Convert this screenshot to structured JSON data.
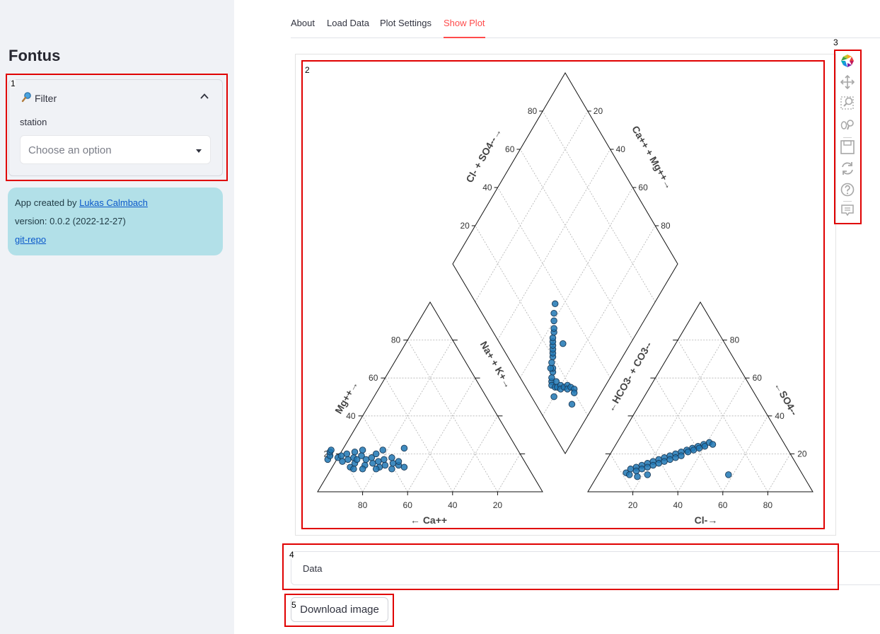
{
  "app": {
    "title": "Fontus"
  },
  "sidebar": {
    "filter": {
      "label": "Filter",
      "station_label": "station",
      "placeholder": "Choose an option"
    },
    "info": {
      "created_prefix": "App created by ",
      "author_link": "Lukas Calmbach",
      "version": "version: 0.0.2 (2022-12-27)",
      "repo_link": "git-repo"
    }
  },
  "tabs": [
    {
      "label": "About"
    },
    {
      "label": "Load Data"
    },
    {
      "label": "Plot Settings"
    },
    {
      "label": "Show Plot",
      "active": true
    }
  ],
  "chart_data": {
    "type": "scatter",
    "subtype": "piper-diagram",
    "marker_color": "#1f77b4",
    "axis_labels": {
      "cation_left": "Mg++",
      "cation_right": "Na+ + K+",
      "cation_bottom": "Ca++",
      "anion_left": "HCO3- + CO3--",
      "anion_right": "SO4--",
      "anion_bottom": "Cl-",
      "diamond_upper_left": "Cl- + SO4--",
      "diamond_upper_right": "Ca++ + Mg++"
    },
    "ticks": [
      20,
      40,
      60,
      80
    ],
    "grid": true,
    "cation_points": [
      {
        "ca": 87,
        "mg": 17
      },
      {
        "ca": 85,
        "mg": 19
      },
      {
        "ca": 84,
        "mg": 21
      },
      {
        "ca": 83,
        "mg": 22
      },
      {
        "ca": 82,
        "mg": 18
      },
      {
        "ca": 81,
        "mg": 16
      },
      {
        "ca": 80,
        "mg": 19
      },
      {
        "ca": 79,
        "mg": 13
      },
      {
        "ca": 78,
        "mg": 17
      },
      {
        "ca": 77,
        "mg": 20
      },
      {
        "ca": 76,
        "mg": 15
      },
      {
        "ca": 75,
        "mg": 18
      },
      {
        "ca": 74,
        "mg": 17
      },
      {
        "ca": 73,
        "mg": 21
      },
      {
        "ca": 72,
        "mg": 14
      },
      {
        "ca": 71,
        "mg": 19
      },
      {
        "ca": 70,
        "mg": 17
      },
      {
        "ca": 69,
        "mg": 22
      },
      {
        "ca": 68,
        "mg": 15
      },
      {
        "ca": 67,
        "mg": 18
      },
      {
        "ca": 66,
        "mg": 13
      },
      {
        "ca": 65,
        "mg": 16
      },
      {
        "ca": 64,
        "mg": 20
      },
      {
        "ca": 63,
        "mg": 14
      },
      {
        "ca": 62,
        "mg": 17
      },
      {
        "ca": 61,
        "mg": 12
      },
      {
        "ca": 60,
        "mg": 22
      },
      {
        "ca": 59,
        "mg": 15
      },
      {
        "ca": 58,
        "mg": 18
      },
      {
        "ca": 57,
        "mg": 14
      },
      {
        "ca": 56,
        "mg": 16
      },
      {
        "ca": 55,
        "mg": 13
      },
      {
        "ca": 78,
        "mg": 12
      },
      {
        "ca": 74,
        "mg": 12
      },
      {
        "ca": 68,
        "mg": 12
      },
      {
        "ca": 50,
        "mg": 23
      }
    ],
    "anion_points": [
      {
        "cl": 12,
        "so4": 10
      },
      {
        "cl": 13,
        "so4": 12
      },
      {
        "cl": 14,
        "so4": 9
      },
      {
        "cl": 15,
        "so4": 13
      },
      {
        "cl": 16,
        "so4": 11
      },
      {
        "cl": 17,
        "so4": 14
      },
      {
        "cl": 18,
        "so4": 12
      },
      {
        "cl": 19,
        "so4": 15
      },
      {
        "cl": 20,
        "so4": 13
      },
      {
        "cl": 21,
        "so4": 16
      },
      {
        "cl": 22,
        "so4": 14
      },
      {
        "cl": 23,
        "so4": 17
      },
      {
        "cl": 24,
        "so4": 15
      },
      {
        "cl": 25,
        "so4": 18
      },
      {
        "cl": 26,
        "so4": 16
      },
      {
        "cl": 27,
        "so4": 19
      },
      {
        "cl": 28,
        "so4": 17
      },
      {
        "cl": 29,
        "so4": 20
      },
      {
        "cl": 30,
        "so4": 18
      },
      {
        "cl": 31,
        "so4": 21
      },
      {
        "cl": 32,
        "so4": 19
      },
      {
        "cl": 33,
        "so4": 22
      },
      {
        "cl": 34,
        "so4": 21
      },
      {
        "cl": 35,
        "so4": 23
      },
      {
        "cl": 36,
        "so4": 22
      },
      {
        "cl": 37,
        "so4": 24
      },
      {
        "cl": 38,
        "so4": 23
      },
      {
        "cl": 39,
        "so4": 25
      },
      {
        "cl": 40,
        "so4": 24
      },
      {
        "cl": 41,
        "so4": 26
      },
      {
        "cl": 43,
        "so4": 25
      },
      {
        "cl": 18,
        "so4": 8
      },
      {
        "cl": 22,
        "so4": 9
      },
      {
        "cl": 58,
        "so4": 9
      }
    ],
    "diamond_points": [
      {
        "cl_so4": 25,
        "ca_mg": 87
      },
      {
        "cl_so4": 24,
        "ca_mg": 88
      },
      {
        "cl_so4": 26,
        "ca_mg": 86
      },
      {
        "cl_so4": 23,
        "ca_mg": 85
      },
      {
        "cl_so4": 27,
        "ca_mg": 84
      },
      {
        "cl_so4": 22,
        "ca_mg": 87
      },
      {
        "cl_so4": 28,
        "ca_mg": 83
      },
      {
        "cl_so4": 21,
        "ca_mg": 86
      },
      {
        "cl_so4": 29,
        "ca_mg": 84
      },
      {
        "cl_so4": 20,
        "ca_mg": 84
      },
      {
        "cl_so4": 30,
        "ca_mg": 82
      },
      {
        "cl_so4": 19,
        "ca_mg": 85
      },
      {
        "cl_so4": 31,
        "ca_mg": 80
      },
      {
        "cl_so4": 18,
        "ca_mg": 83
      },
      {
        "cl_so4": 32,
        "ca_mg": 79
      },
      {
        "cl_so4": 17,
        "ca_mg": 81
      },
      {
        "cl_so4": 33,
        "ca_mg": 78
      },
      {
        "cl_so4": 16,
        "ca_mg": 82
      },
      {
        "cl_so4": 34,
        "ca_mg": 77
      },
      {
        "cl_so4": 15,
        "ca_mg": 80
      },
      {
        "cl_so4": 35,
        "ca_mg": 76
      },
      {
        "cl_so4": 36,
        "ca_mg": 75
      },
      {
        "cl_so4": 37,
        "ca_mg": 73
      },
      {
        "cl_so4": 38,
        "ca_mg": 72
      },
      {
        "cl_so4": 13,
        "ca_mg": 79
      },
      {
        "cl_so4": 12,
        "ca_mg": 80
      },
      {
        "cl_so4": 40,
        "ca_mg": 70
      },
      {
        "cl_so4": 42,
        "ca_mg": 68
      },
      {
        "cl_so4": 20,
        "ca_mg": 90
      },
      {
        "cl_so4": 10,
        "ca_mg": 84
      },
      {
        "cl_so4": 44,
        "ca_mg": 65
      },
      {
        "cl_so4": 30,
        "ca_mg": 72
      }
    ]
  },
  "toolbar": {
    "items": [
      {
        "name": "bokeh-logo-icon"
      },
      {
        "name": "pan-icon"
      },
      {
        "name": "box-zoom-icon"
      },
      {
        "name": "wheel-zoom-icon"
      },
      {
        "name": "save-icon"
      },
      {
        "name": "reset-icon"
      },
      {
        "name": "help-icon"
      },
      {
        "name": "hover-icon"
      }
    ]
  },
  "data_expander": {
    "label": "Data"
  },
  "download": {
    "label": "Download image"
  },
  "annotations": [
    {
      "label": "1"
    },
    {
      "label": "2"
    },
    {
      "label": "3"
    },
    {
      "label": "4"
    },
    {
      "label": "5"
    }
  ]
}
